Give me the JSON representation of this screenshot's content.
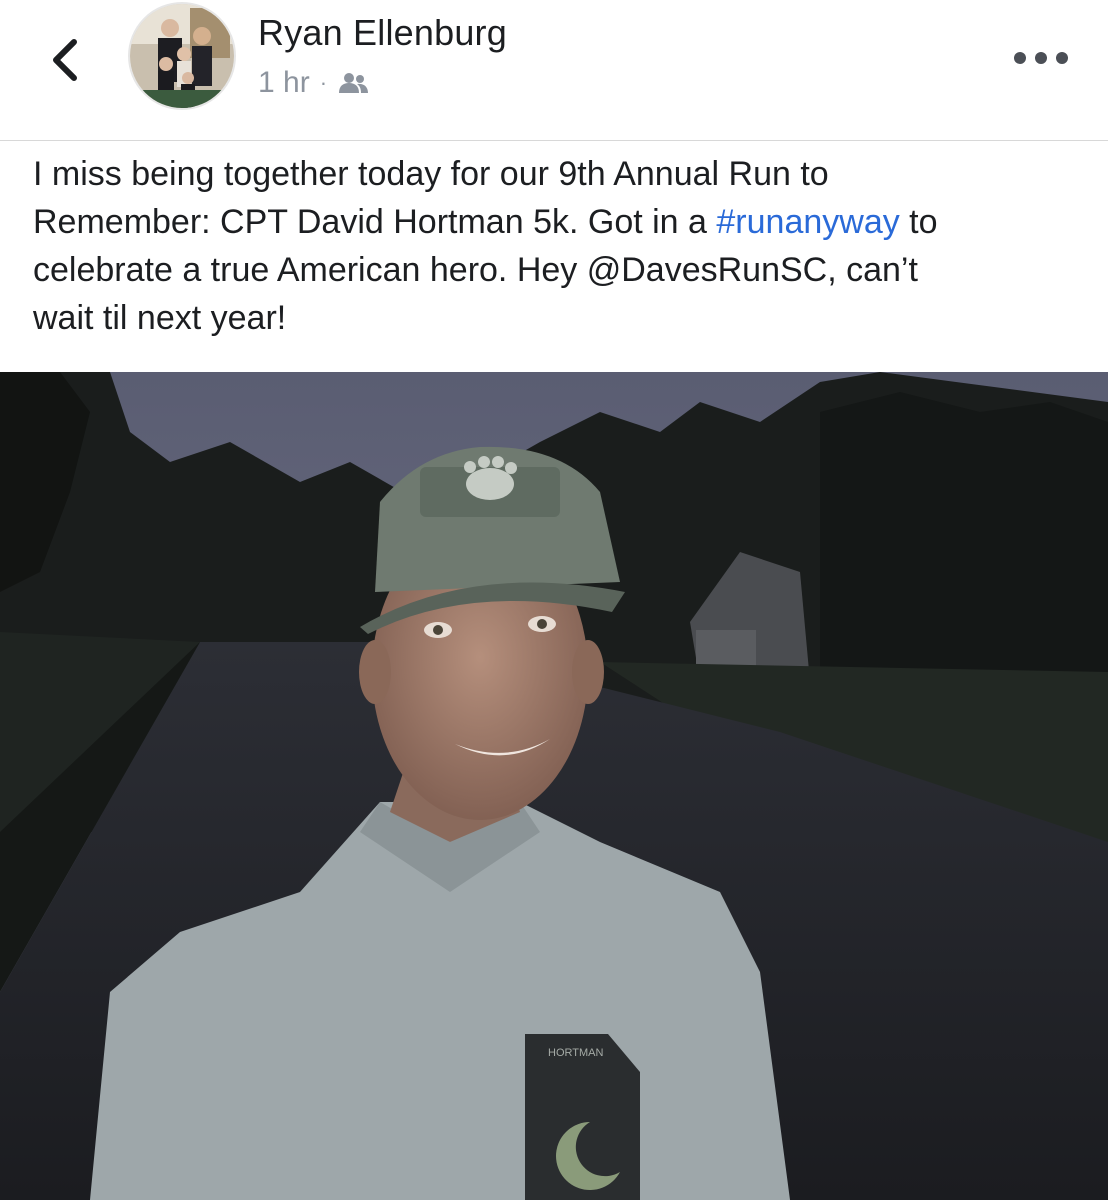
{
  "header": {
    "back_icon": "chevron-left-icon",
    "author_name": "Ryan Ellenburg",
    "timestamp": "1 hr",
    "separator": "·",
    "audience_icon": "friends-icon",
    "more_icon": "more-horizontal-icon"
  },
  "post": {
    "line1": "I miss being together today for our 9th Annual Run to",
    "line2_before": "Remember: CPT David Hortman 5k.  Got in a ",
    "line2_hashtag": "#runanyway",
    "line2_after": " to",
    "line3": "celebrate a true American hero.  Hey @DavesRunSC, can’t",
    "line4": "wait til next year!"
  },
  "photo": {
    "shirt_text": "HORTMAN"
  },
  "colors": {
    "hashtag": "#2a6ad8",
    "text": "#1c1e21",
    "meta": "#8d949e"
  }
}
